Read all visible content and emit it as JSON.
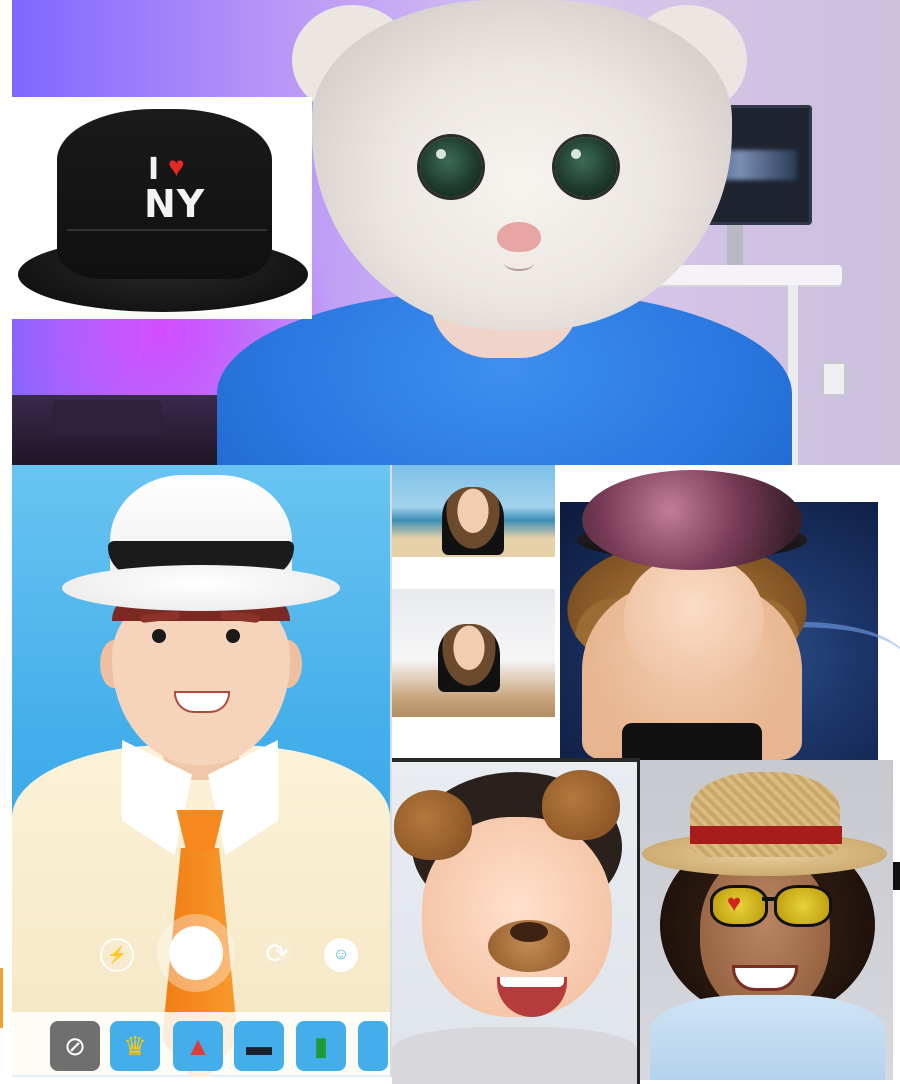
{
  "hat_card": {
    "logo_i": "I",
    "logo_heart": "♥",
    "logo_ny": "NY"
  },
  "phone_camera": {
    "controls": [
      {
        "name": "flash",
        "glyph": "⚡"
      },
      {
        "name": "flip",
        "glyph": "⟳"
      },
      {
        "name": "face",
        "glyph": "☺"
      }
    ],
    "tray": [
      {
        "name": "none",
        "glyph": "⊘",
        "bg": "#6f6f6f",
        "color": "#ffffff"
      },
      {
        "name": "crown",
        "glyph": "♛",
        "bg": "#43aeea",
        "color": "#f5c518"
      },
      {
        "name": "santa-hat",
        "glyph": "▲",
        "bg": "#43aeea",
        "color": "#e23b3b"
      },
      {
        "name": "police-cap",
        "glyph": "▬",
        "bg": "#43aeea",
        "color": "#1b2333"
      },
      {
        "name": "leprechaun-hat",
        "glyph": "▮",
        "bg": "#43aeea",
        "color": "#1f9a37"
      }
    ]
  },
  "colors": {
    "accent_blue": "#43aeea",
    "shirt_blue": "#2a78e0",
    "tie_orange": "#f6881e"
  }
}
